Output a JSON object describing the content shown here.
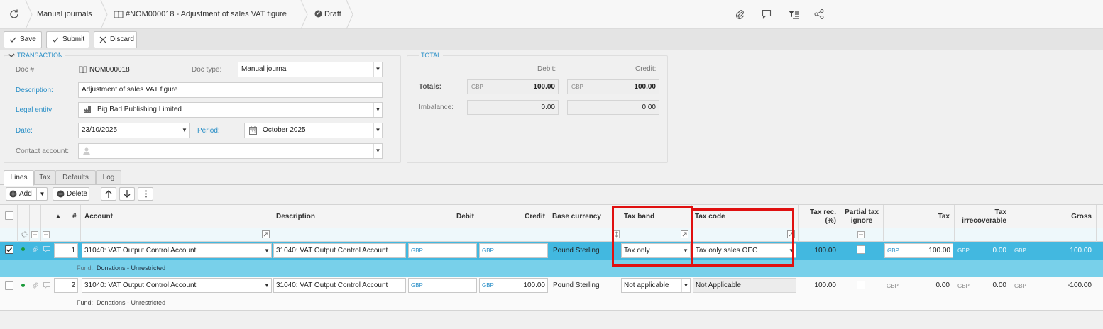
{
  "breadcrumb": {
    "refresh_icon": "refresh-icon",
    "module": "Manual journals",
    "document": "#NOM000018 - Adjustment of sales VAT figure",
    "status": "Draft"
  },
  "toolbar": {
    "save": "Save",
    "submit": "Submit",
    "discard": "Discard"
  },
  "transaction": {
    "title": "TRANSACTION",
    "doc_no_label": "Doc #:",
    "doc_no": "NOM000018",
    "doc_type_label": "Doc type:",
    "doc_type": "Manual journal",
    "description_label": "Description:",
    "description": "Adjustment of sales VAT figure",
    "legal_entity_label": "Legal entity:",
    "legal_entity": "Big Bad Publishing Limited",
    "date_label": "Date:",
    "date": "23/10/2025",
    "period_label": "Period:",
    "period": "October 2025",
    "contact_label": "Contact account:",
    "contact": ""
  },
  "total": {
    "title": "TOTAL",
    "debit_label": "Debit:",
    "credit_label": "Credit:",
    "totals_label": "Totals:",
    "imbalance_label": "Imbalance:",
    "currency": "GBP",
    "debit_total": "100.00",
    "credit_total": "100.00",
    "debit_imbalance": "0.00",
    "credit_imbalance": "0.00"
  },
  "tabs": [
    "Lines",
    "Tax",
    "Defaults",
    "Log"
  ],
  "lines_toolbar": {
    "add": "Add",
    "delete": "Delete"
  },
  "grid": {
    "headers": {
      "sort": "▲",
      "num": "#",
      "account": "Account",
      "description": "Description",
      "debit": "Debit",
      "credit": "Credit",
      "base_currency": "Base currency",
      "tax_band": "Tax band",
      "tax_code": "Tax code",
      "tax_rec_1": "Tax rec.",
      "tax_rec_2": "(%)",
      "partial_1": "Partial tax",
      "partial_2": "ignore",
      "tax": "Tax",
      "tax_irr_1": "Tax",
      "tax_irr_2": "irrecoverable",
      "gross": "Gross"
    },
    "rows": [
      {
        "num": "1",
        "account": "31040: VAT Output Control Account",
        "description": "31040: VAT Output Control Account",
        "debit_cur": "GBP",
        "debit": "",
        "credit_cur": "GBP",
        "credit": "",
        "base_currency": "Pound Sterling",
        "tax_band": "Tax only",
        "tax_code": "Tax only sales OEC",
        "tax_rec": "100.00",
        "tax_cur": "GBP",
        "tax": "100.00",
        "tax_irr_cur": "GBP",
        "tax_irr": "0.00",
        "gross_cur": "GBP",
        "gross": "100.00",
        "fund_label": "Fund:",
        "fund": "Donations - Unrestricted"
      },
      {
        "num": "2",
        "account": "31040: VAT Output Control Account",
        "description": "31040: VAT Output Control Account",
        "debit_cur": "GBP",
        "debit": "",
        "credit_cur": "GBP",
        "credit": "100.00",
        "base_currency": "Pound Sterling",
        "tax_band": "Not applicable",
        "tax_code": "Not Applicable",
        "tax_rec": "100.00",
        "tax_cur": "GBP",
        "tax": "0.00",
        "tax_irr_cur": "GBP",
        "tax_irr": "0.00",
        "gross_cur": "GBP",
        "gross": "-100.00",
        "fund_label": "Fund:",
        "fund": "Donations - Unrestricted"
      }
    ]
  },
  "colors": {
    "accent": "#2a8fc7",
    "selected_row": "#42b8e0",
    "selected_subrow": "#78d0ea",
    "highlight_box": "#e01010",
    "status_dot": "#1a9a3a"
  }
}
